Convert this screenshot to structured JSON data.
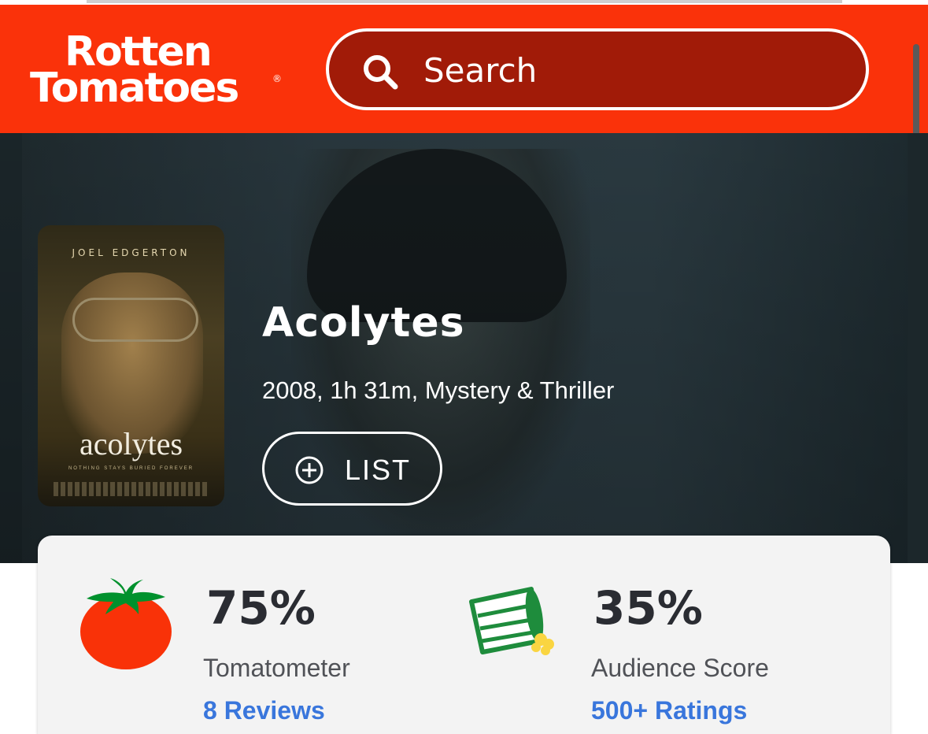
{
  "header": {
    "logo_line1": "Rotten",
    "logo_line2": "Tomatoes",
    "logo_reg": "®",
    "search_placeholder": "Search"
  },
  "movie": {
    "title": "Acolytes",
    "meta": "2008, 1h 31m, Mystery & Thriller",
    "list_button": "LIST",
    "poster": {
      "actor": "JOEL EDGERTON",
      "title": "acolytes",
      "tagline": "NOTHING STAYS BURIED FOREVER"
    }
  },
  "scores": {
    "tomatometer": {
      "value": "75%",
      "label": "Tomatometer",
      "link": "8 Reviews",
      "icon": "fresh-tomato-icon"
    },
    "audience": {
      "value": "35%",
      "label": "Audience Score",
      "link": "500+ Ratings",
      "icon": "spilled-popcorn-icon"
    }
  },
  "colors": {
    "brand_red": "#fa320a",
    "search_bg": "#a11b08",
    "link_blue": "#3976dc",
    "tomato_red": "#f93208",
    "popcorn_green": "#1e8c3c"
  }
}
